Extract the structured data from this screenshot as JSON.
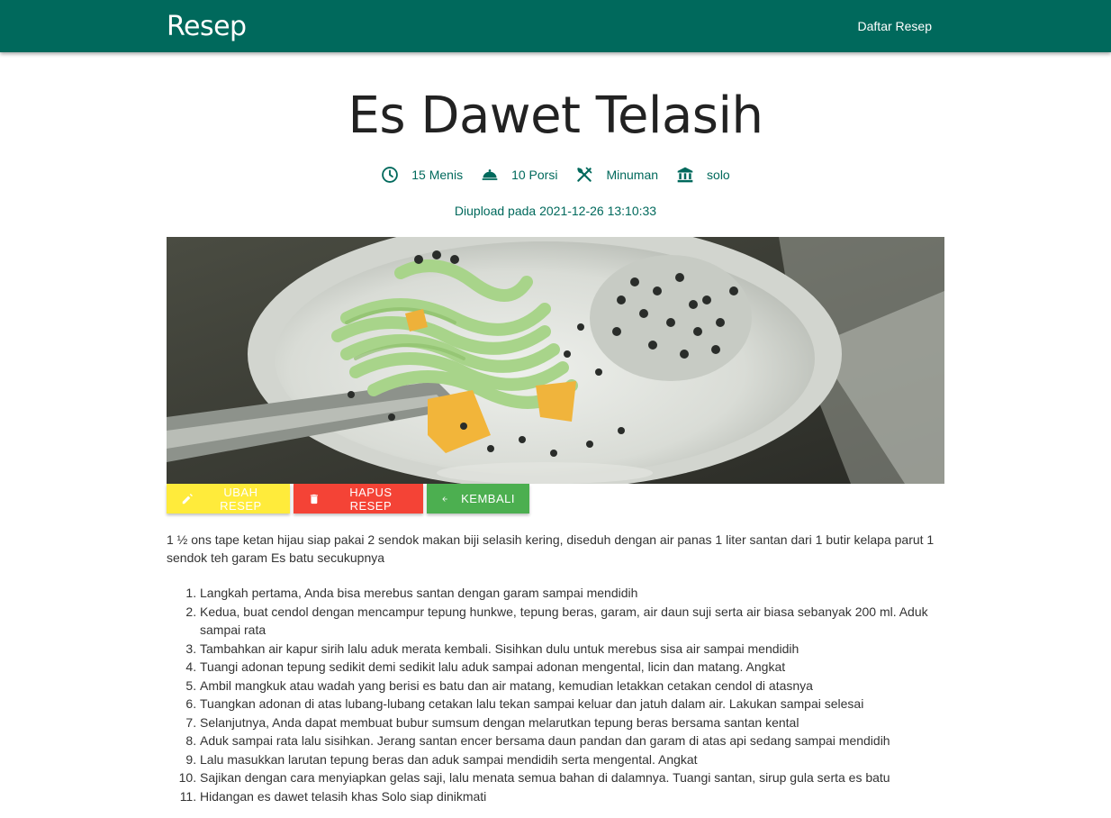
{
  "nav": {
    "brand": "Resep",
    "link": "Daftar Resep"
  },
  "recipe": {
    "title": "Es Dawet Telasih",
    "time": "15 Menis",
    "portions": "10 Porsi",
    "category": "Minuman",
    "origin": "solo",
    "uploaded": "Diupload pada 2021-12-26 13:10:33",
    "ingredients": "1 ½ ons tape ketan hijau siap pakai 2 sendok makan biji selasih kering, diseduh dengan air panas 1 liter santan dari 1 butir kelapa parut 1 sendok teh garam Es batu secukupnya",
    "steps": [
      "Langkah pertama, Anda bisa merebus santan dengan garam sampai mendidih",
      "Kedua, buat cendol dengan mencampur tepung hunkwe, tepung beras, garam, air daun suji serta air biasa sebanyak 200 ml. Aduk sampai rata",
      "Tambahkan air kapur sirih lalu aduk merata kembali. Sisihkan dulu untuk merebus sisa air sampai mendidih",
      "Tuangi adonan tepung sedikit demi sedikit lalu aduk sampai adonan mengental, licin dan matang. Angkat",
      "Ambil mangkuk atau wadah yang berisi es batu dan air matang, kemudian letakkan cetakan cendol di atasnya",
      "Tuangkan adonan di atas lubang-lubang cetakan lalu tekan sampai keluar dan jatuh dalam air. Lakukan sampai selesai",
      "Selanjutnya, Anda dapat membuat bubur sumsum dengan melarutkan tepung beras bersama santan kental",
      "Aduk sampai rata lalu sisihkan. Jerang santan encer bersama daun pandan dan garam di atas api sedang sampai mendidih",
      "Lalu masukkan larutan tepung beras dan aduk sampai mendidih serta mengental. Angkat",
      "Sajikan dengan cara menyiapkan gelas saji, lalu menata semua bahan di dalamnya. Tuangi santan, sirup gula serta es batu",
      "Hidangan es dawet telasih khas Solo siap dinikmati"
    ]
  },
  "buttons": {
    "edit": "Ubah Resep",
    "delete": "Hapus Resep",
    "back": "Kembali"
  },
  "icons": {
    "time": "clock-icon",
    "portions": "food-cover-icon",
    "category": "utensils-icon",
    "origin": "museum-icon",
    "edit": "pencil-icon",
    "delete": "trash-icon",
    "back": "arrow-left-icon"
  },
  "colors": {
    "primary": "#00695c",
    "edit": "#ffeb3b",
    "delete": "#f44336",
    "back": "#4caf50"
  }
}
